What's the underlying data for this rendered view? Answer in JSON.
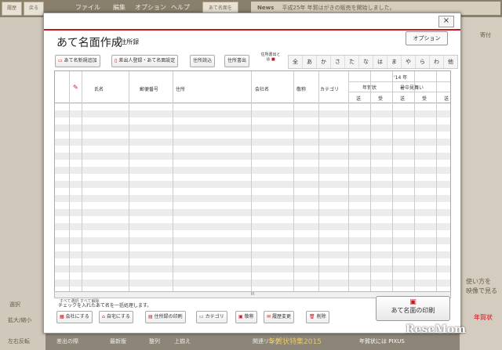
{
  "background": {
    "top_buttons": [
      "履歴",
      "戻る"
    ],
    "menu": [
      "ファイル",
      "編集",
      "オプション",
      "ヘルプ"
    ],
    "top_right_btn": "あて名面を",
    "news_label": "News",
    "news_text": "平成25年 年賀はがきの販売を開始しました。",
    "left_items": [
      "選択",
      "拡大/縮小",
      "左右反転"
    ],
    "right_items": [
      "寄付",
      "使い方を",
      "映像で見る",
      "年賀状"
    ],
    "bottom_items": [
      "差出の際",
      "最新版",
      "整列",
      "上揃え"
    ],
    "bottom_banner": "年賀状特集2015",
    "bottom_right": "年賀状には PIXUS",
    "bottom_link": "関連リンク"
  },
  "dialog": {
    "close": "×",
    "title": "あて名面作成",
    "subtitle": "/ 住所録",
    "options_button": "オプション",
    "toolbar": {
      "new": "あて名新規追加",
      "sender": "差出人登録・あて名面設定",
      "import": "住所読込",
      "export": "住所書出",
      "export_note": "住所書出とは"
    },
    "kana_tabs": [
      "全",
      "あ",
      "か",
      "さ",
      "た",
      "な",
      "は",
      "ま",
      "や",
      "ら",
      "わ",
      "他"
    ],
    "table": {
      "headers": {
        "name": "氏名",
        "postal": "郵便番号",
        "address": "住所",
        "company": "会社名",
        "honorific": "敬称",
        "category": "カテゴリ",
        "year": "'14 年",
        "nengajo": "年賀状",
        "shochu": "暑中見舞い",
        "sent": "送",
        "received": "受"
      }
    },
    "scroll_indicator": "III",
    "select_all": "すべて選択",
    "deselect_all": "すべて解除",
    "bulk_note": "チェックを入れたあて名を一括処理します。",
    "bulk_buttons": {
      "company": "会社にする",
      "home": "自宅にする",
      "print_list": "住所録の印刷",
      "category": "カテゴリ",
      "honorific": "敬称",
      "history": "履歴変更",
      "delete": "削除"
    },
    "print_button": "あて名面の印刷"
  },
  "watermark": "ReseMom"
}
